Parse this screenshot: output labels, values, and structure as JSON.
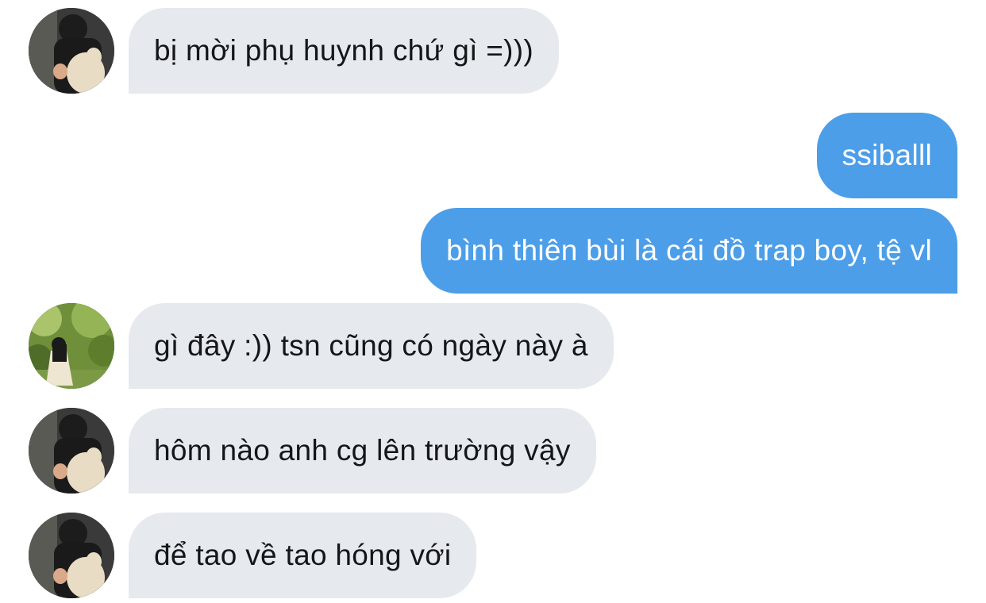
{
  "conversation": {
    "messages": [
      {
        "direction": "incoming",
        "sender_avatar": "boy-with-dog-avatar",
        "text": "bị mời phụ huynh chứ gì =)))"
      },
      {
        "direction": "outgoing",
        "text": "ssiballl"
      },
      {
        "direction": "outgoing",
        "text": "bình thiên bùi là cái đồ trap boy, tệ vl"
      },
      {
        "direction": "incoming",
        "sender_avatar": "girl-in-garden-avatar",
        "text": "gì đây :)) tsn cũng có ngày này à"
      },
      {
        "direction": "incoming",
        "sender_avatar": "boy-with-dog-avatar",
        "text": "hôm nào anh cg lên trường vậy"
      },
      {
        "direction": "incoming",
        "sender_avatar": "boy-with-dog-avatar",
        "text": "để tao về tao hóng với"
      }
    ]
  },
  "colors": {
    "incoming_bubble": "#e6e9ed",
    "outgoing_bubble": "#4c9ee9",
    "incoming_text": "#14171a",
    "outgoing_text": "#ffffff"
  }
}
